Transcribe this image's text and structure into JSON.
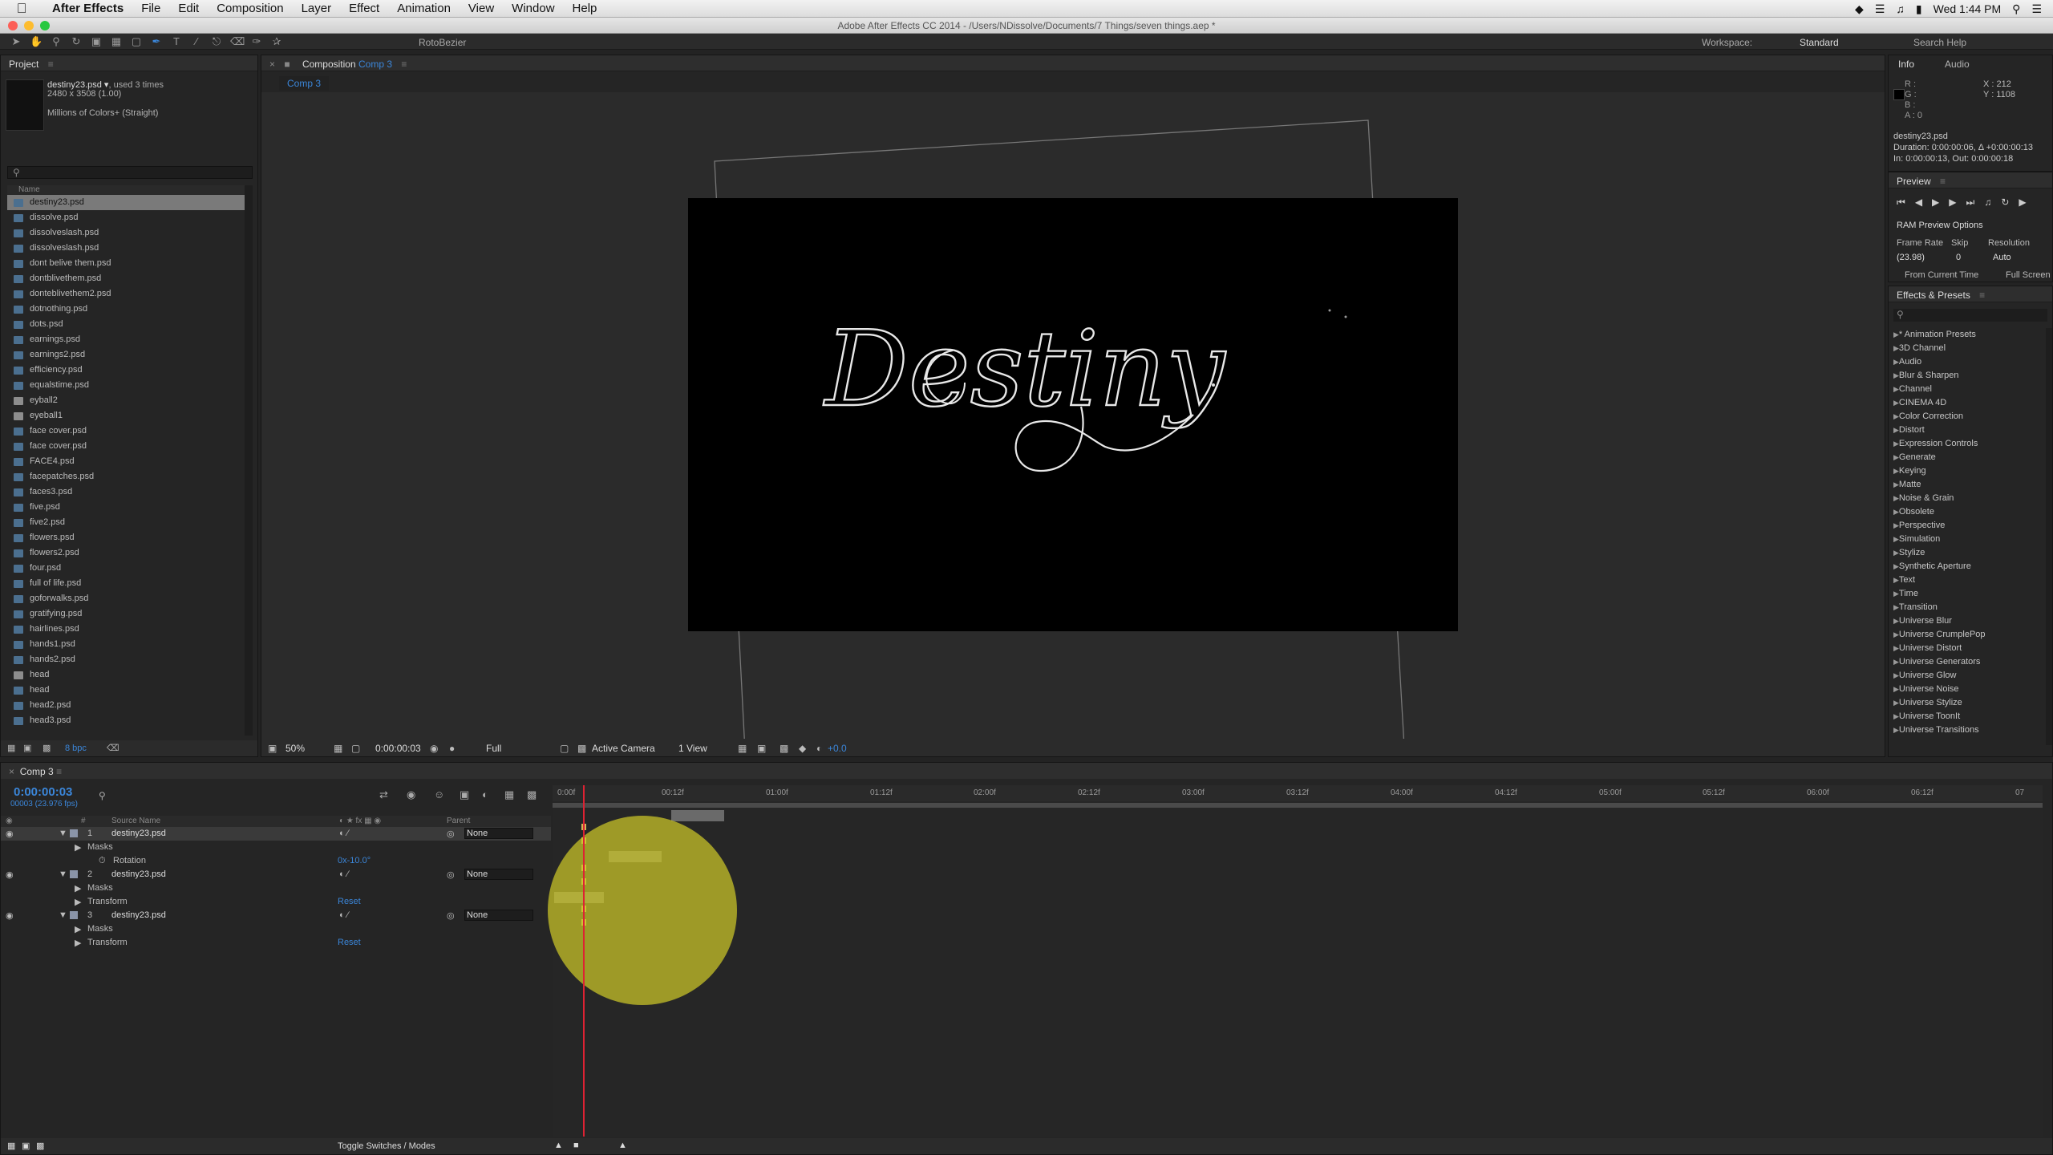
{
  "menubar": {
    "items": [
      "After Effects",
      "File",
      "Edit",
      "Composition",
      "Layer",
      "Effect",
      "Animation",
      "View",
      "Window",
      "Help"
    ],
    "clock": "Wed 1:44 PM"
  },
  "window": {
    "title": "Adobe After Effects CC 2014 - /Users/NDissolve/Documents/7 Things/seven things.aep *"
  },
  "toolbar": {
    "roto_label": "RotoBezier",
    "workspace_label": "Workspace:",
    "workspace_value": "Standard",
    "search_placeholder": "Search Help"
  },
  "project": {
    "panel_title": "Project",
    "selected_file": "destiny23.psd ▾",
    "used_text": ", used 3 times",
    "dimensions": "2480 x 3508 (1.00)",
    "colors": "Millions of Colors+ (Straight)",
    "column_name": "Name",
    "bpc": "8 bpc",
    "files": [
      {
        "name": "destiny23.psd",
        "selected": true
      },
      {
        "name": "dissolve.psd"
      },
      {
        "name": "dissolveslash.psd"
      },
      {
        "name": "dissolveslash.psd"
      },
      {
        "name": "dont belive them.psd"
      },
      {
        "name": "dontblivethem.psd"
      },
      {
        "name": "donteblivethem2.psd"
      },
      {
        "name": "dotnothing.psd"
      },
      {
        "name": "dots.psd"
      },
      {
        "name": "earnings.psd"
      },
      {
        "name": "earnings2.psd"
      },
      {
        "name": "efficiency.psd"
      },
      {
        "name": "equalstime.psd"
      },
      {
        "name": "eyball2",
        "comp": true
      },
      {
        "name": "eyeball1",
        "comp": true
      },
      {
        "name": "face cover.psd"
      },
      {
        "name": "face cover.psd"
      },
      {
        "name": "FACE4.psd"
      },
      {
        "name": "facepatches.psd"
      },
      {
        "name": "faces3.psd"
      },
      {
        "name": "five.psd"
      },
      {
        "name": "five2.psd"
      },
      {
        "name": "flowers.psd"
      },
      {
        "name": "flowers2.psd"
      },
      {
        "name": "four.psd"
      },
      {
        "name": "full of life.psd"
      },
      {
        "name": "goforwalks.psd"
      },
      {
        "name": "gratifying.psd"
      },
      {
        "name": "hairlines.psd"
      },
      {
        "name": "hands1.psd"
      },
      {
        "name": "hands2.psd"
      },
      {
        "name": "head",
        "comp": true
      },
      {
        "name": "head"
      },
      {
        "name": "head2.psd"
      },
      {
        "name": "head3.psd"
      }
    ]
  },
  "composition": {
    "panel_label": "Composition",
    "comp_name": "Comp 3",
    "tab": "Comp 3",
    "artwork_text": "Destiny",
    "footer": {
      "zoom": "50%",
      "timecode": "0:00:00:03",
      "resolution": "Full",
      "camera": "Active Camera",
      "views": "1 View",
      "exposure": "+0.0"
    }
  },
  "info": {
    "tab_info": "Info",
    "tab_audio": "Audio",
    "r": "R :",
    "g": "G :",
    "b": "B :",
    "a": "A : 0",
    "x": "X : 212",
    "y": "Y : 1108",
    "line1": "destiny23.psd",
    "line2": "Duration: 0:00:00:06, Δ +0:00:00:13",
    "line3": "In: 0:00:00:13, Out: 0:00:00:18"
  },
  "preview": {
    "title": "Preview",
    "ram_options": "RAM Preview Options",
    "frame_rate_label": "Frame Rate",
    "skip_label": "Skip",
    "resolution_label": "Resolution",
    "frame_rate_value": "(23.98)",
    "skip_value": "0",
    "resolution_value": "Auto",
    "from_current": "From Current Time",
    "full_screen": "Full Screen"
  },
  "effects": {
    "title": "Effects & Presets",
    "items": [
      "* Animation Presets",
      "3D Channel",
      "Audio",
      "Blur & Sharpen",
      "Channel",
      "CINEMA 4D",
      "Color Correction",
      "Distort",
      "Expression Controls",
      "Generate",
      "Keying",
      "Matte",
      "Noise & Grain",
      "Obsolete",
      "Perspective",
      "Simulation",
      "Stylize",
      "Synthetic Aperture",
      "Text",
      "Time",
      "Transition",
      "Universe Blur",
      "Universe CrumplePop",
      "Universe Distort",
      "Universe Generators",
      "Universe Glow",
      "Universe Noise",
      "Universe Stylize",
      "Universe ToonIt",
      "Universe Transitions"
    ]
  },
  "timeline": {
    "tab": "Comp 3",
    "current_time": "0:00:00:03",
    "fps": "00003 (23.976 fps)",
    "col_source": "Source Name",
    "col_parent": "Parent",
    "layers": [
      {
        "num": "1",
        "name": "destiny23.psd",
        "parent": "None"
      },
      {
        "num": "2",
        "name": "destiny23.psd",
        "parent": "None"
      },
      {
        "num": "3",
        "name": "destiny23.psd",
        "parent": "None"
      }
    ],
    "prop_masks": "Masks",
    "prop_rotation": "Rotation",
    "rotation_value": "0x-10.0°",
    "prop_transform": "Transform",
    "reset": "Reset",
    "ruler": [
      "0:00f",
      "00:12f",
      "01:00f",
      "01:12f",
      "02:00f",
      "02:12f",
      "03:00f",
      "03:12f",
      "04:00f",
      "04:12f",
      "05:00f",
      "05:12f",
      "06:00f",
      "06:12f",
      "07"
    ],
    "toggle": "Toggle Switches / Modes"
  }
}
